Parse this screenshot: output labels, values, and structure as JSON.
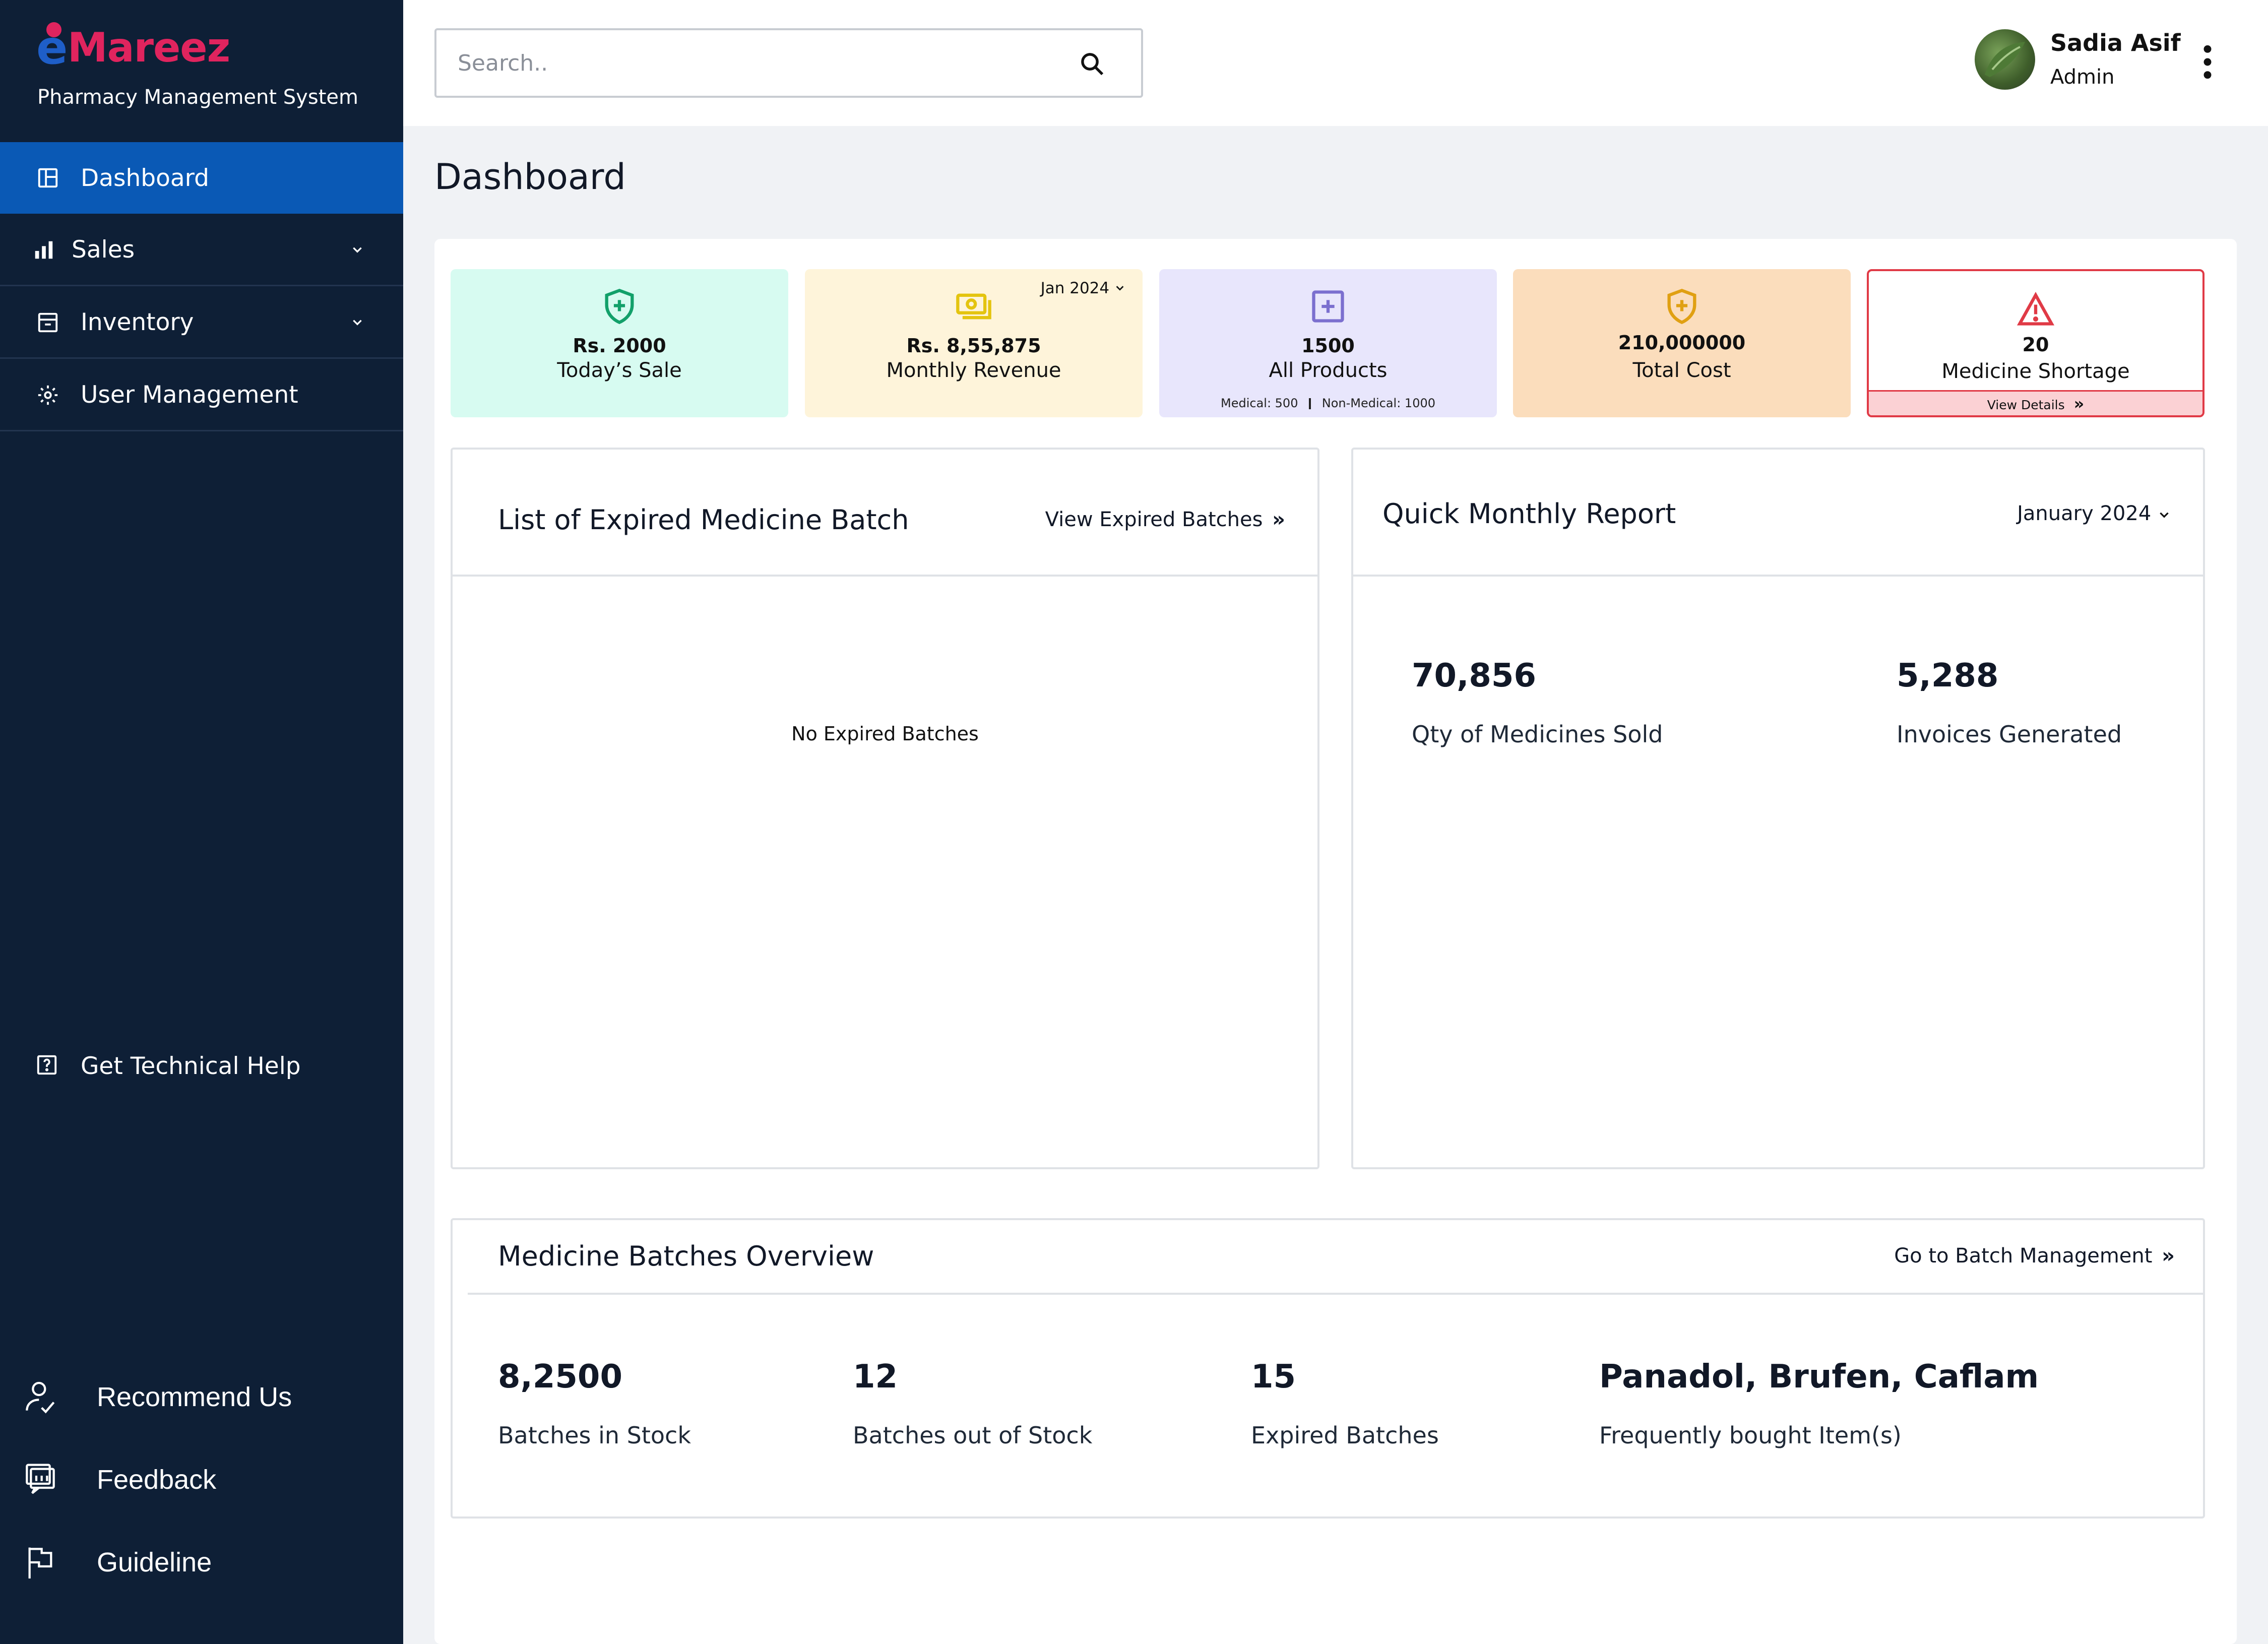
{
  "brand": {
    "name": "Mareez",
    "subtitle": "Pharmacy Management System"
  },
  "sidebar": {
    "items": [
      {
        "label": "Dashboard",
        "icon": "dashboard-icon",
        "active": true
      },
      {
        "label": "Sales",
        "icon": "bar-chart-icon",
        "expandable": true
      },
      {
        "label": "Inventory",
        "icon": "archive-box-icon",
        "expandable": true
      },
      {
        "label": "User Management",
        "icon": "gear-icon"
      }
    ],
    "help": {
      "label": "Get Technical Help",
      "icon": "question-icon"
    },
    "footer": [
      {
        "label": "Recommend Us",
        "icon": "user-check-icon"
      },
      {
        "label": "Feedback",
        "icon": "feedback-icon"
      },
      {
        "label": "Guideline",
        "icon": "flag-icon"
      }
    ]
  },
  "header": {
    "search_placeholder": "Search..",
    "user_name": "Sadia Asif",
    "user_role": "Admin"
  },
  "page": {
    "title": "Dashboard"
  },
  "stats": {
    "todays_sale": {
      "value": "Rs. 2000",
      "label": "Today’s Sale"
    },
    "monthly_revenue": {
      "value": "Rs. 8,55,875",
      "label": "Monthly Revenue",
      "period": "Jan 2024"
    },
    "all_products": {
      "value": "1500",
      "label": "All Products",
      "medical": "Medical: 500",
      "non_medical": "Non-Medical: 1000"
    },
    "total_cost": {
      "value": "210,000000",
      "label": "Total Cost"
    },
    "shortage": {
      "value": "20",
      "label": "Medicine Shortage",
      "link": "View Details"
    }
  },
  "expired": {
    "title": "List of Expired Medicine Batch",
    "link": "View Expired Batches",
    "empty": "No Expired Batches"
  },
  "monthly_report": {
    "title": "Quick Monthly Report",
    "period": "January 2024",
    "qty_value": "70,856",
    "qty_label": "Qty of Medicines Sold",
    "inv_value": "5,288",
    "inv_label": "Invoices Generated"
  },
  "batches": {
    "title": "Medicine Batches Overview",
    "link": "Go to Batch Management",
    "in_stock": {
      "value": "8,2500",
      "label": "Batches in Stock"
    },
    "out_stock": {
      "value": "12",
      "label": "Batches out of Stock"
    },
    "expired": {
      "value": "15",
      "label": "Expired Batches"
    },
    "frequent": {
      "value": "Panadol, Brufen, Caflam",
      "label": "Frequently bought Item(s)"
    }
  },
  "colors": {
    "sidebar_bg": "#0e1f36",
    "active_nav": "#0a59b5",
    "brand_pink": "#e0245e",
    "alert_red": "#e03a46"
  }
}
